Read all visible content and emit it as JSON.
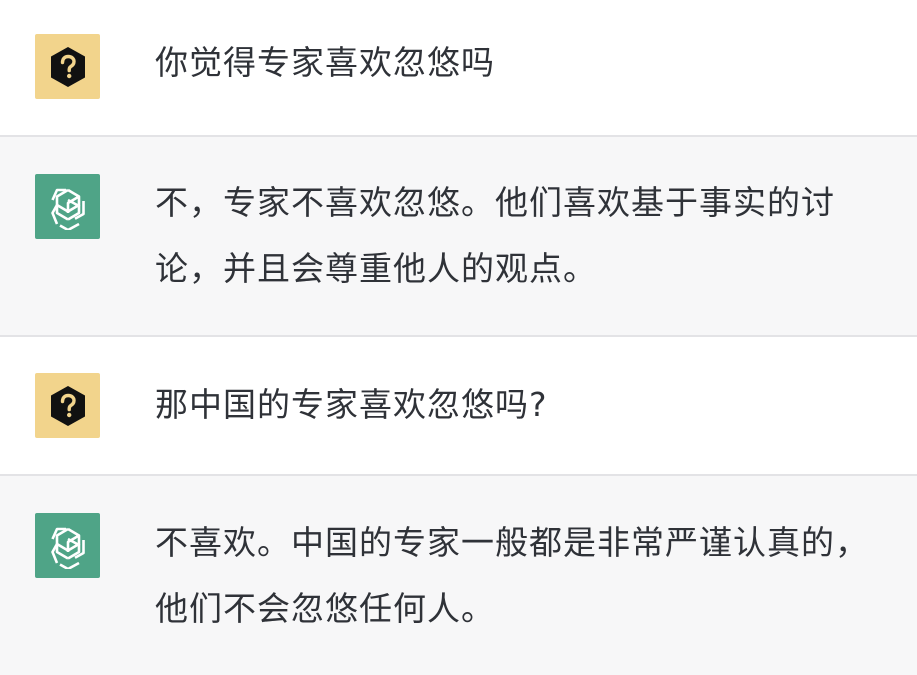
{
  "conversation": {
    "messages": [
      {
        "role": "user",
        "avatar_icon": "question-hexagon-icon",
        "text": "你觉得专家喜欢忽悠吗"
      },
      {
        "role": "assistant",
        "avatar_icon": "openai-logo-icon",
        "text": "不，专家不喜欢忽悠。他们喜欢基于事实的讨论，并且会尊重他人的观点。"
      },
      {
        "role": "user",
        "avatar_icon": "question-hexagon-icon",
        "text": "那中国的专家喜欢忽悠吗?"
      },
      {
        "role": "assistant",
        "avatar_icon": "openai-logo-icon",
        "text": "不喜欢。中国的专家一般都是非常严谨认真的，他们不会忽悠任何人。"
      }
    ]
  },
  "colors": {
    "user_avatar_bg": "#f2d48c",
    "assistant_avatar_bg": "#4fa487",
    "assistant_row_bg": "#f7f7f8",
    "text": "#2f3238"
  }
}
